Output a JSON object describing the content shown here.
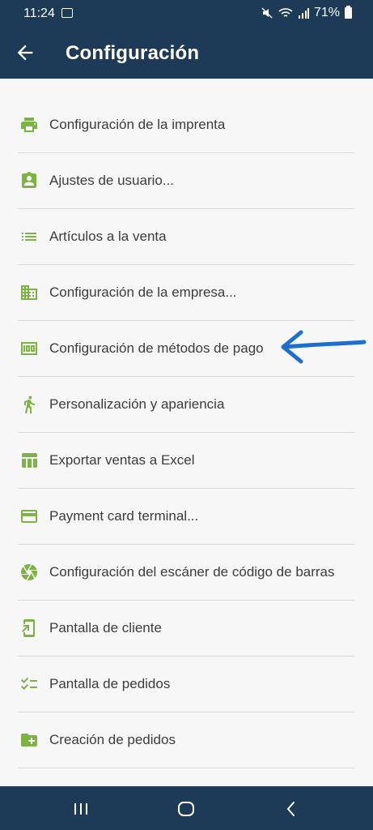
{
  "status": {
    "time": "11:24",
    "battery": "71%"
  },
  "header": {
    "title": "Configuración"
  },
  "colors": {
    "bar": "#1d3b56",
    "icon": "#7cb342",
    "arrow": "#1a6fcf"
  },
  "items": [
    {
      "label": "Configuración de la imprenta",
      "icon": "printer-icon"
    },
    {
      "label": "Ajustes de usuario...",
      "icon": "user-badge-icon"
    },
    {
      "label": "Artículos a la venta",
      "icon": "list-icon"
    },
    {
      "label": "Configuración de la empresa...",
      "icon": "building-icon"
    },
    {
      "label": "Configuración de métodos de pago",
      "icon": "money-icon"
    },
    {
      "label": "Personalización y apariencia",
      "icon": "person-run-icon"
    },
    {
      "label": "Exportar ventas a Excel",
      "icon": "table-icon"
    },
    {
      "label": "Payment card terminal...",
      "icon": "credit-card-icon"
    },
    {
      "label": "Configuración del escáner de código de barras",
      "icon": "aperture-icon"
    },
    {
      "label": "Pantalla de cliente",
      "icon": "phone-forward-icon"
    },
    {
      "label": "Pantalla de pedidos",
      "icon": "checklist-icon"
    },
    {
      "label": "Creación de pedidos",
      "icon": "folder-add-icon"
    }
  ]
}
